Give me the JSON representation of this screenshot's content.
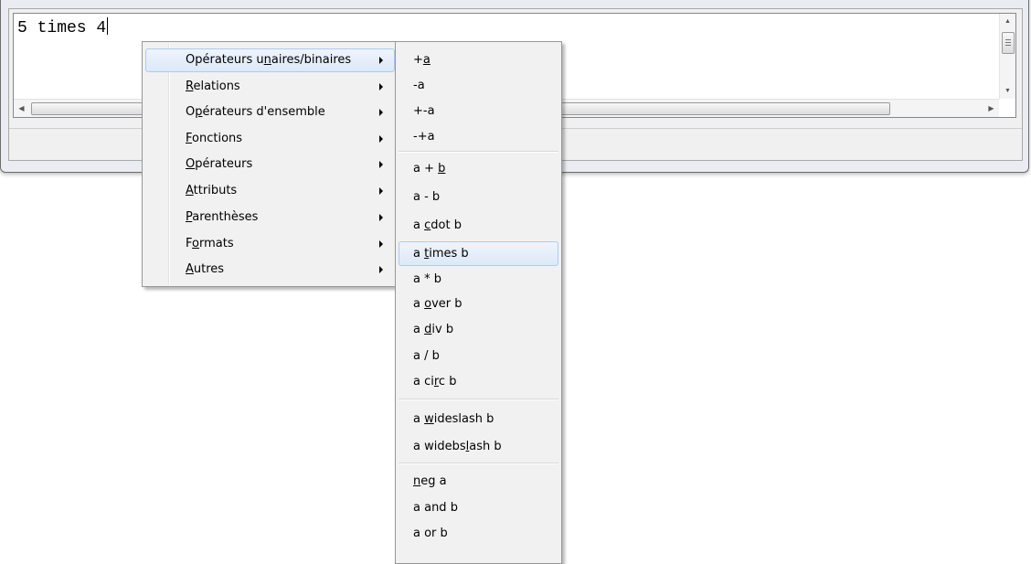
{
  "editor": {
    "text": "5 times 4"
  },
  "context_menu": {
    "items": [
      {
        "label": "Opérateurs unaires/binaires",
        "pre": "Opérateurs u",
        "acc": "n",
        "post": "aires/binaires",
        "has_submenu": true,
        "highlighted": true
      },
      {
        "label": "Relations",
        "pre": "",
        "acc": "R",
        "post": "elations",
        "has_submenu": true
      },
      {
        "label": "Opérateurs d'ensemble",
        "pre": "O",
        "acc": "p",
        "post": "érateurs d'ensemble",
        "has_submenu": true
      },
      {
        "label": "Fonctions",
        "pre": "",
        "acc": "F",
        "post": "onctions",
        "has_submenu": true
      },
      {
        "label": "Opérateurs",
        "pre": "",
        "acc": "O",
        "post": "pérateurs",
        "has_submenu": true
      },
      {
        "label": "Attributs",
        "pre": "",
        "acc": "A",
        "post": "ttributs",
        "has_submenu": true
      },
      {
        "label": "Parenthèses",
        "pre": "",
        "acc": "P",
        "post": "arenthèses",
        "has_submenu": true
      },
      {
        "label": "Formats",
        "pre": "F",
        "acc": "o",
        "post": "rmats",
        "has_submenu": true
      },
      {
        "label": "Autres",
        "pre": "",
        "acc": "A",
        "post": "utres",
        "has_submenu": true
      }
    ]
  },
  "submenu": {
    "groups": [
      [
        {
          "label": "+a",
          "pre": "+",
          "acc": "a",
          "post": ""
        },
        {
          "label": "-a",
          "pre": "-a",
          "acc": "",
          "post": ""
        },
        {
          "label": "+-a",
          "pre": "+-a",
          "acc": "",
          "post": ""
        },
        {
          "label": "-+a",
          "pre": "-+a",
          "acc": "",
          "post": ""
        }
      ],
      [
        {
          "label": "a + b",
          "pre": "a + ",
          "acc": "b",
          "post": ""
        },
        {
          "label": "a - b",
          "pre": "a - b",
          "acc": "",
          "post": ""
        },
        {
          "label": "a cdot b",
          "pre": "a ",
          "acc": "c",
          "post": "dot b"
        },
        {
          "label": "a times b",
          "pre": "a ",
          "acc": "t",
          "post": "imes b",
          "highlighted": true
        },
        {
          "label": "a * b",
          "pre": "a * b",
          "acc": "",
          "post": ""
        },
        {
          "label": "a over b",
          "pre": "a ",
          "acc": "o",
          "post": "ver b"
        },
        {
          "label": "a div b",
          "pre": "a ",
          "acc": "d",
          "post": "iv b"
        },
        {
          "label": "a / b",
          "pre": "a / b",
          "acc": "",
          "post": ""
        },
        {
          "label": "a circ b",
          "pre": "a ci",
          "acc": "r",
          "post": "c b"
        }
      ],
      [
        {
          "label": "a wideslash b",
          "pre": "a ",
          "acc": "w",
          "post": "ideslash b"
        },
        {
          "label": "a widebslash b",
          "pre": "a widebs",
          "acc": "l",
          "post": "ash b"
        }
      ],
      [
        {
          "label": "neg a",
          "pre": "",
          "acc": "n",
          "post": "eg a"
        },
        {
          "label": "a and b",
          "pre": "a and b",
          "acc": "",
          "post": ""
        },
        {
          "label": "a or b",
          "pre": "a or b",
          "acc": "",
          "post": ""
        }
      ]
    ]
  }
}
